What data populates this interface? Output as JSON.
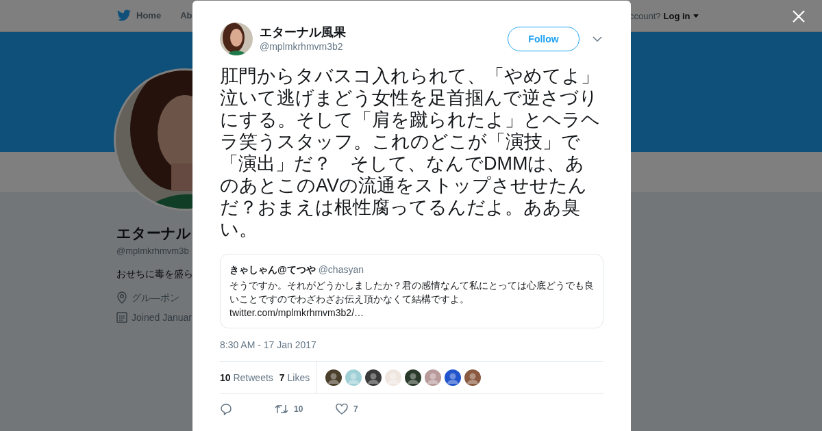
{
  "nav": {
    "items": [
      {
        "label": "Home",
        "selected": false
      },
      {
        "label": "Ab",
        "selected": false
      }
    ],
    "account_prompt": "ccount?",
    "login": "Log in"
  },
  "profile": {
    "name": "エターナル",
    "handle": "@mplmkrhmvm3b",
    "bio": "おせちに毒を盛ら",
    "location": "グル―ポン",
    "joined": "Joined Januar"
  },
  "tweet": {
    "author": {
      "name": "エターナル風果",
      "handle": "@mplmkrhmvm3b2"
    },
    "follow_button": "Follow",
    "text": "肛門からタバスコ入れられて、「やめてよ」泣いて逃げまどう女性を足首掴んで逆さづりにする。そして「肩を蹴られたよ」とヘラヘラ笑うスタッフ。これのどこが「演技」で「演出」だ？　そして、なんでDMMは、あのあとこのAVの流通をストップさせせたんだ？おまえは根性腐ってるんだよ。ああ臭い。",
    "quote": {
      "name": "きゃしゃん@てつや",
      "handle": "@chasyan",
      "text": "そうですか。それがどうかしましたか？君の感情なんて私にとっては心底どうでも良いことですのでわざわざお伝え頂かなくて結構ですよ。",
      "link": "twitter.com/mplmkrhmvm3b2/…"
    },
    "timestamp": "8:30 AM - 17 Jan 2017",
    "stats": [
      {
        "count": "10",
        "label": "Retweets"
      },
      {
        "count": "7",
        "label": "Likes"
      }
    ],
    "liker_avatars": [
      {
        "color": "#4a3f2a"
      },
      {
        "color": "#9fd0d6"
      },
      {
        "color": "#3a3a3a"
      },
      {
        "color": "#f0e6e0"
      },
      {
        "color": "#2a3a2a"
      },
      {
        "color": "#b89a9a"
      },
      {
        "color": "#2255cc"
      },
      {
        "color": "#8a5a40"
      }
    ],
    "actions": [
      {
        "kind": "reply"
      },
      {
        "kind": "retweet",
        "count": "10"
      },
      {
        "kind": "like",
        "count": "7"
      }
    ]
  }
}
